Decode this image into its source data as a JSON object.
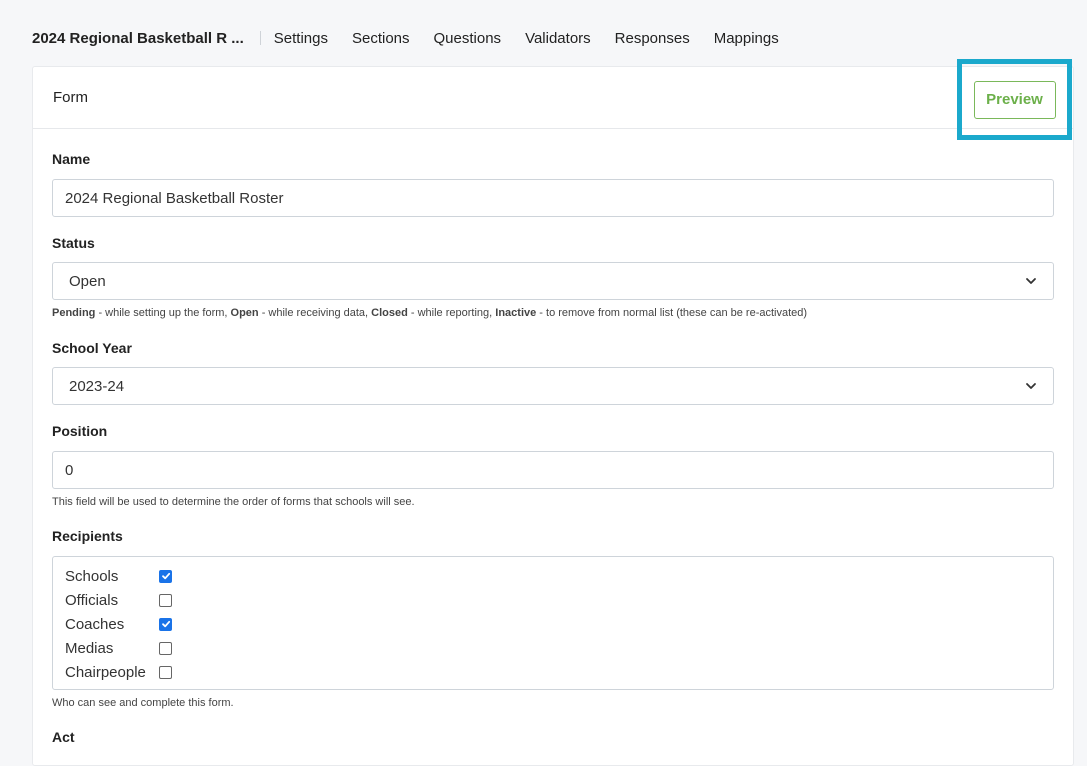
{
  "nav": {
    "form_title": "2024 Regional Basketball R ...",
    "links": [
      "Settings",
      "Sections",
      "Questions",
      "Validators",
      "Responses",
      "Mappings"
    ]
  },
  "card": {
    "header_title": "Form",
    "preview_label": "Preview"
  },
  "fields": {
    "name": {
      "label": "Name",
      "value": "2024 Regional Basketball Roster"
    },
    "status": {
      "label": "Status",
      "value": "Open",
      "help": [
        {
          "b": "Pending",
          "t": " - while setting up the form, "
        },
        {
          "b": "Open",
          "t": " - while receiving data, "
        },
        {
          "b": "Closed",
          "t": " - while reporting, "
        },
        {
          "b": "Inactive",
          "t": " - to remove from normal list (these can be re-activated)"
        }
      ]
    },
    "school_year": {
      "label": "School Year",
      "value": "2023-24"
    },
    "position": {
      "label": "Position",
      "value": "0",
      "help": "This field will be used to determine the order of forms that schools will see."
    },
    "recipients": {
      "label": "Recipients",
      "items": [
        {
          "label": "Schools",
          "checked": true
        },
        {
          "label": "Officials",
          "checked": false
        },
        {
          "label": "Coaches",
          "checked": true
        },
        {
          "label": "Medias",
          "checked": false
        },
        {
          "label": "Chairpeople",
          "checked": false
        }
      ],
      "help": "Who can see and complete this form."
    },
    "next_label_partial": "Act"
  },
  "colors": {
    "highlight": "#1ba9cc",
    "preview_green": "#6cb04a",
    "checkbox_blue": "#1a73e8"
  }
}
